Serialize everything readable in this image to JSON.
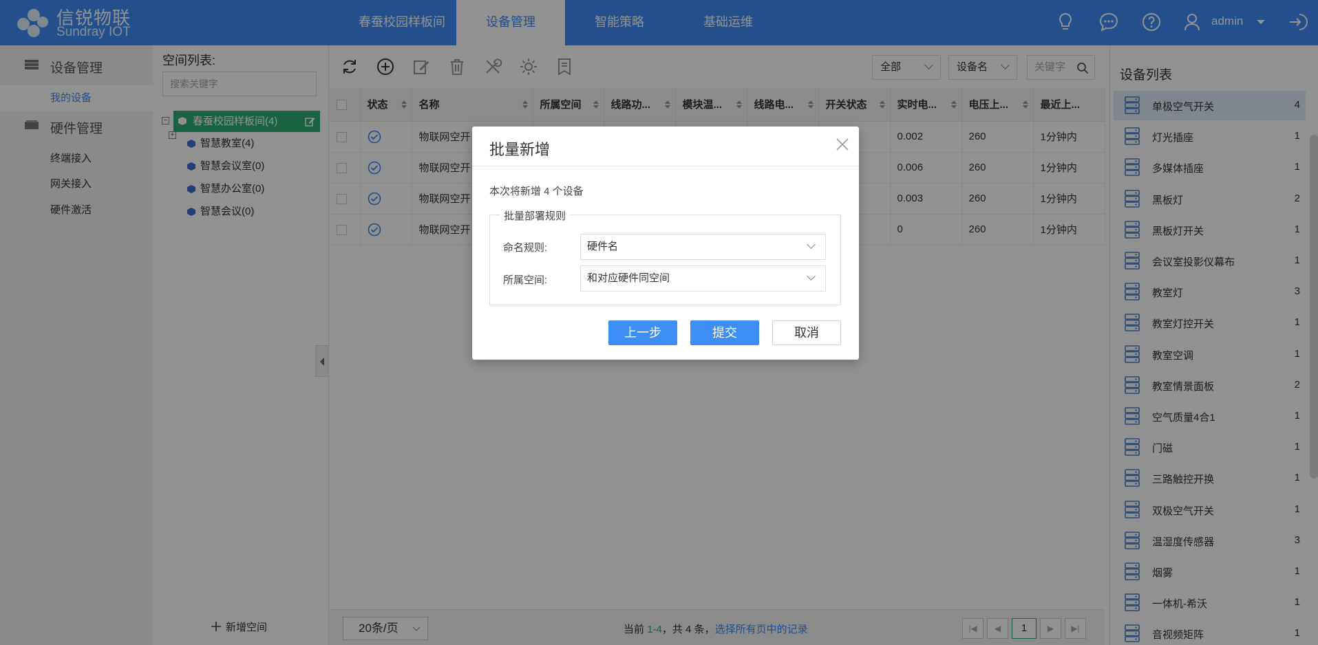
{
  "brand": {
    "name_cn": "信锐物联",
    "name_en": "Sundray IOT"
  },
  "topnav": {
    "tabs": [
      {
        "label": "春蚕校园样板间",
        "active": false
      },
      {
        "label": "设备管理",
        "active": true
      },
      {
        "label": "智能策略",
        "active": false
      },
      {
        "label": "基础运维",
        "active": false
      }
    ],
    "user": "admin",
    "icons": [
      "lightbulb-icon",
      "chat-icon",
      "help-icon",
      "user-icon",
      "chevron-down-icon",
      "logout-icon"
    ]
  },
  "leftnav": {
    "groups": [
      {
        "label": "设备管理",
        "icon": "database-icon",
        "items": [
          {
            "label": "我的设备",
            "active": true
          }
        ]
      },
      {
        "label": "硬件管理",
        "icon": "hardware-icon",
        "items": [
          {
            "label": "终端接入"
          },
          {
            "label": "网关接入"
          },
          {
            "label": "硬件激活"
          }
        ]
      }
    ]
  },
  "spaces": {
    "title": "空间列表:",
    "search_placeholder": "搜索关键字",
    "root": "春蚕校园样板间(4)",
    "children": [
      "智慧教室(4)",
      "智慧会议室(0)",
      "智慧办公室(0)",
      "智慧会议(0)"
    ],
    "add_label": "新增空间"
  },
  "toolbar": {
    "filter_scope": "全部",
    "filter_field": "设备名",
    "keyword_placeholder": "关键字"
  },
  "table": {
    "columns": [
      "状态",
      "名称",
      "所属空间",
      "线路功...",
      "模块温...",
      "线路电...",
      "开关状态",
      "实时电...",
      "电压上...",
      "最近上..."
    ],
    "rows": [
      {
        "name": "物联网空开",
        "realtime": "0.002",
        "voltage": "260",
        "recent": "1分钟内"
      },
      {
        "name": "物联网空开",
        "realtime": "0.006",
        "voltage": "260",
        "recent": "1分钟内"
      },
      {
        "name": "物联网空开",
        "realtime": "0.003",
        "voltage": "260",
        "recent": "1分钟内"
      },
      {
        "name": "物联网空开",
        "realtime": "0",
        "voltage": "260",
        "recent": "1分钟内"
      }
    ]
  },
  "footer": {
    "page_size": "20条/页",
    "info_prefix": "当前",
    "info_range": "1-4",
    "info_total": "，共 4 条，",
    "select_all": "选择所有页中的记录",
    "current_page": "1"
  },
  "devlist": {
    "title": "设备列表",
    "items": [
      {
        "name": "单极空气开关",
        "count": "4",
        "active": true
      },
      {
        "name": "灯光插座",
        "count": "1"
      },
      {
        "name": "多媒体插座",
        "count": "1"
      },
      {
        "name": "黑板灯",
        "count": "2"
      },
      {
        "name": "黑板灯开关",
        "count": "1"
      },
      {
        "name": "会议室投影仪幕布",
        "count": "1"
      },
      {
        "name": "教室灯",
        "count": "3"
      },
      {
        "name": "教室灯控开关",
        "count": "1"
      },
      {
        "name": "教室空调",
        "count": "1"
      },
      {
        "name": "教室情景面板",
        "count": "2"
      },
      {
        "name": "空气质量4合1",
        "count": "1"
      },
      {
        "name": "门磁",
        "count": "1"
      },
      {
        "name": "三路触控开换",
        "count": "1"
      },
      {
        "name": "双极空气开关",
        "count": "1"
      },
      {
        "name": "温湿度传感器",
        "count": "3"
      },
      {
        "name": "烟雾",
        "count": "1"
      },
      {
        "name": "一体机-希沃",
        "count": "1"
      },
      {
        "name": "音视频矩阵",
        "count": "1"
      }
    ]
  },
  "modal": {
    "title": "批量新增",
    "info": "本次将新增 4 个设备",
    "group_label": "批量部署规则",
    "naming_label": "命名规则:",
    "naming_value": "硬件名",
    "space_label": "所属空间:",
    "space_value": "和对应硬件同空间",
    "prev_label": "上一步",
    "submit_label": "提交",
    "cancel_label": "取消"
  },
  "colors": {
    "primary": "#3e8ef7",
    "tree_active": "#2cae77",
    "overlay": "rgba(0,0,0,0.43)"
  }
}
